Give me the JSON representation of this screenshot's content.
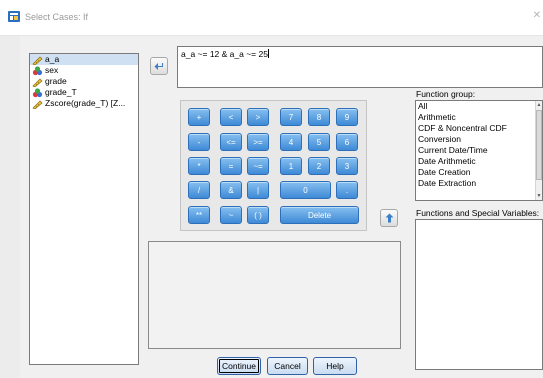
{
  "window": {
    "title": "Select Cases: If",
    "close_glyph": "✕"
  },
  "variables": [
    {
      "label": "a_a",
      "icon": "scale-ruler-icon",
      "selected": true
    },
    {
      "label": "sex",
      "icon": "nominal-icon",
      "selected": false
    },
    {
      "label": "grade",
      "icon": "scale-ruler-icon",
      "selected": false
    },
    {
      "label": "grade_T",
      "icon": "nominal-icon",
      "selected": false
    },
    {
      "label": "Zscore(grade_T) [Z...",
      "icon": "scale-ruler-icon",
      "selected": false
    }
  ],
  "expression": {
    "value": "a_a ~= 12 & a_a ~= 25"
  },
  "keypad": {
    "plus": "+",
    "lt": "<",
    "gt": ">",
    "k7": "7",
    "k8": "8",
    "k9": "9",
    "minus": "-",
    "le": "<=",
    "ge": ">=",
    "k4": "4",
    "k5": "5",
    "k6": "6",
    "times": "*",
    "eq": "=",
    "ne": "~=",
    "k1": "1",
    "k2": "2",
    "k3": "3",
    "div": "/",
    "and": "&",
    "or": "|",
    "k0": "0",
    "dot": ".",
    "pow": "**",
    "not": "~",
    "parens": "( )",
    "delete": "Delete"
  },
  "function_group": {
    "label": "Function group:",
    "items": [
      "All",
      "Arithmetic",
      "CDF & Noncentral CDF",
      "Conversion",
      "Current Date/Time",
      "Date Arithmetic",
      "Date Creation",
      "Date Extraction"
    ]
  },
  "functions_label": "Functions and Special Variables:",
  "buttons": {
    "continue": "Continue",
    "cancel": "Cancel",
    "help": "Help"
  },
  "colors": {
    "key_blue": "#3f8ad6",
    "selection": "#cfe0f3"
  }
}
